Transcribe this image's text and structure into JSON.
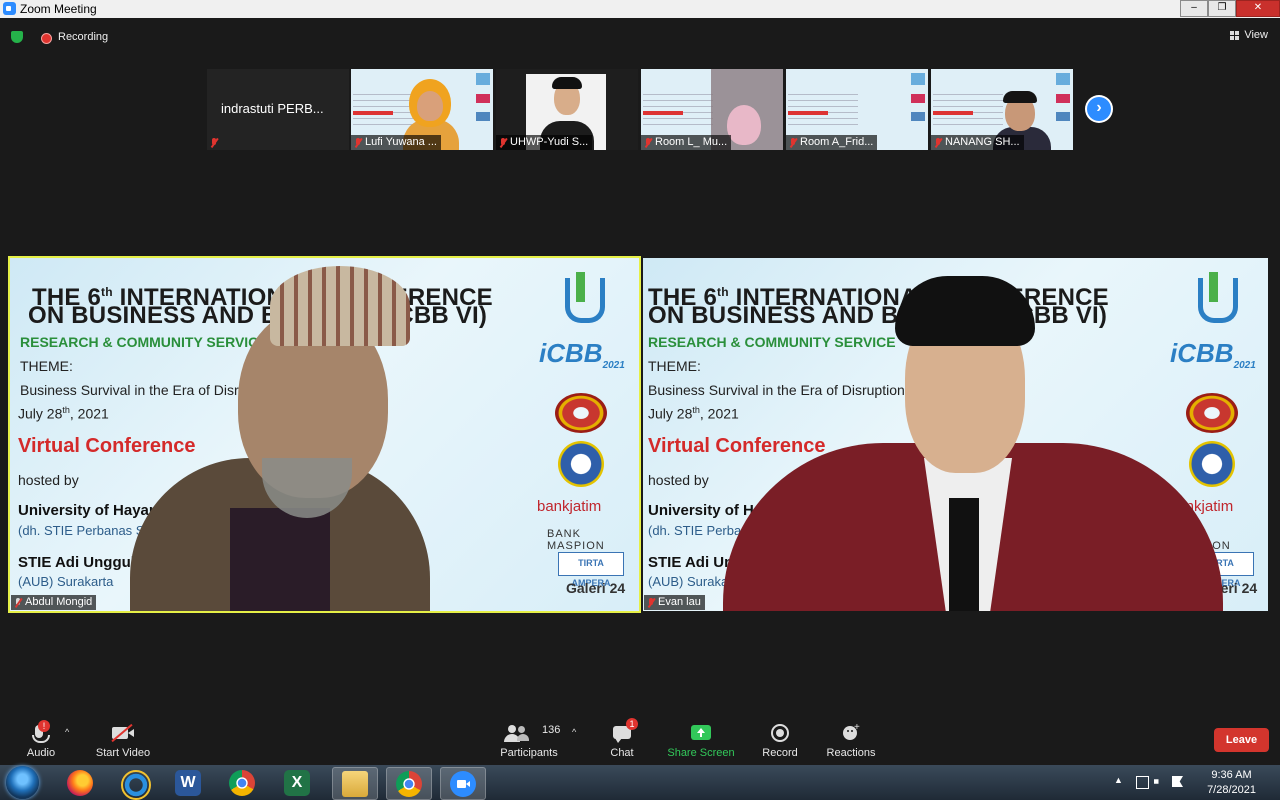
{
  "window": {
    "title": "Zoom Meeting",
    "controls": [
      "–",
      "❐",
      "✕"
    ]
  },
  "topbar": {
    "recording_label": "Recording",
    "view_label": "View"
  },
  "thumbnails": [
    {
      "name": "indrastuti  PERB...",
      "type": "name-only"
    },
    {
      "name": "Lufi Yuwana ...",
      "type": "video"
    },
    {
      "name": "UHWP-Yudi S...",
      "type": "video"
    },
    {
      "name": "Room L_ Mu...",
      "type": "video"
    },
    {
      "name": "Room A_Frid...",
      "type": "video"
    },
    {
      "name": "NANANG SH...",
      "type": "video"
    }
  ],
  "main_videos": [
    {
      "name": "Abdul Mongid",
      "active": true
    },
    {
      "name": "Evan lau",
      "active": false
    }
  ],
  "slide": {
    "title_line1": "THE 6",
    "title_sup": "th",
    "title_line1_rest": " INTERNATIONAL CONFERENCE",
    "title_line2": "ON BUSINESS AND BANKING (ICBB VI)",
    "research": "RESEARCH & COMMUNITY SERVICE",
    "theme_label": "THEME:",
    "theme": "Business Survival in the Era of Disruption",
    "date": "July 28",
    "date_sup": "th",
    "date_rest": ", 2021",
    "virtual": "Virtual Conference",
    "hosted": "hosted by",
    "univ": "University of Hayam Wuruk Perbanas",
    "univ_sub": "(dh. STIE Perbanas Surabaya)",
    "stie": "STIE Adi Unggul Bhirawa",
    "stie_sub": "(AUB) Surakarta",
    "icbb": "iCBB",
    "icbb_year": "2021",
    "bank": "bankjatim",
    "maspion": "BANK MASPION",
    "tirta": "TIRTA AMPERA",
    "galeri": "Galeri 24"
  },
  "toolbar": {
    "audio_label": "Audio",
    "audio_badge": "!",
    "video_label": "Start Video",
    "participants_count": "136",
    "participants_label": "Participants",
    "chat_label": "Chat",
    "chat_badge": "1",
    "share_label": "Share Screen",
    "record_label": "Record",
    "reactions_label": "Reactions",
    "leave_label": "Leave"
  },
  "taskbar": {
    "time": "9:36 AM",
    "date": "7/28/2021"
  },
  "colors": {
    "zoom_blue": "#2d8cff",
    "share_green": "#32c85a",
    "leave_red": "#d3352d",
    "active_speaker": "#e6f046"
  }
}
